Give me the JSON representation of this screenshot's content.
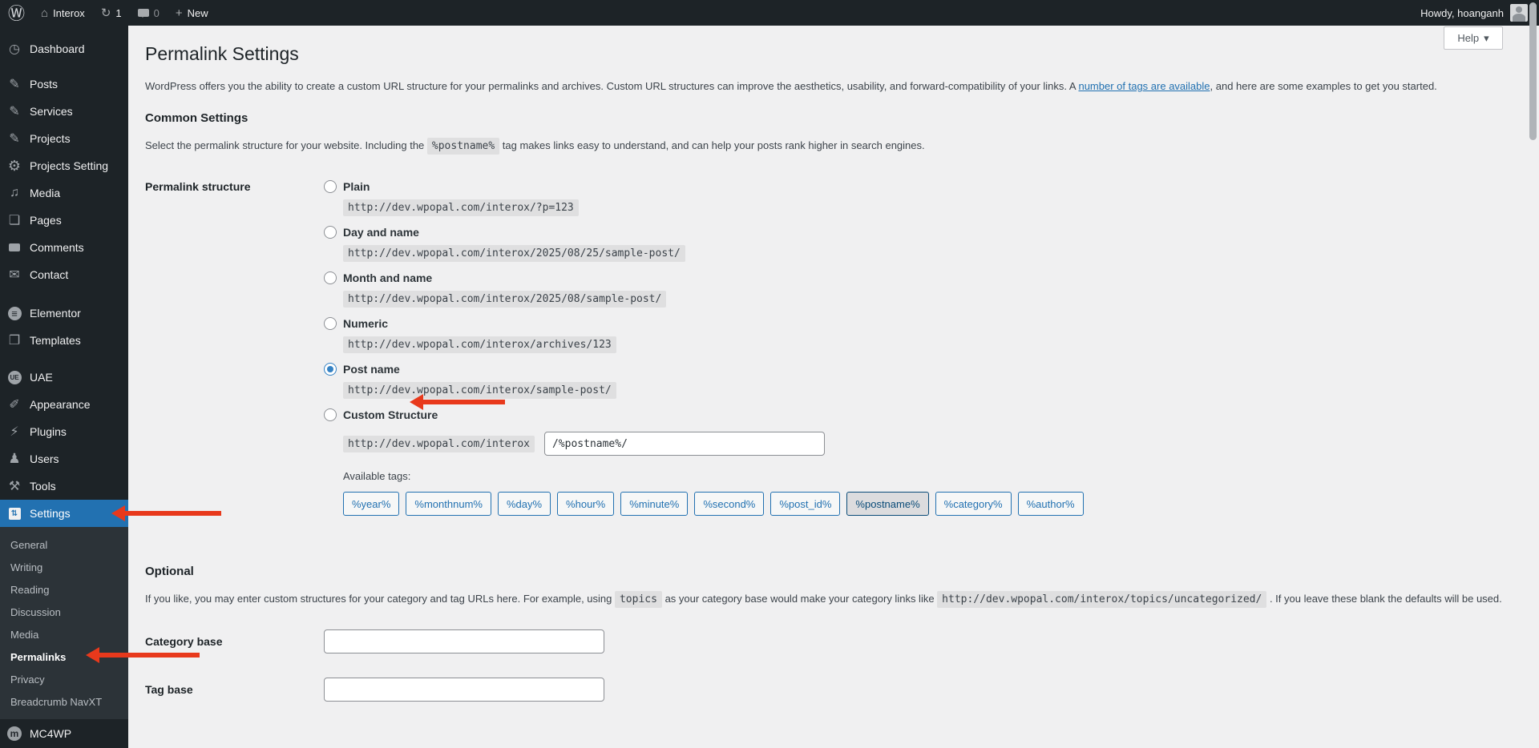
{
  "admin_bar": {
    "site_name": "Interox",
    "update_count": "1",
    "comment_count": "0",
    "new_label": "New",
    "howdy_text": "Howdy, hoanganh"
  },
  "sidebar": {
    "items": [
      {
        "label": "Dashboard",
        "icon": "dashboard-icon"
      },
      {
        "label": "Posts",
        "icon": "pin-icon"
      },
      {
        "label": "Services",
        "icon": "pin-icon"
      },
      {
        "label": "Projects",
        "icon": "pin-icon"
      },
      {
        "label": "Projects Setting",
        "icon": "gear-icon"
      },
      {
        "label": "Media",
        "icon": "media-icon"
      },
      {
        "label": "Pages",
        "icon": "pages-icon"
      },
      {
        "label": "Comments",
        "icon": "comment-bubble-icon"
      },
      {
        "label": "Contact",
        "icon": "mail-icon"
      },
      {
        "label": "Elementor",
        "icon": "elementor-icon"
      },
      {
        "label": "Templates",
        "icon": "folder-icon"
      },
      {
        "label": "UAE",
        "icon": "uae-icon"
      },
      {
        "label": "Appearance",
        "icon": "brush-icon"
      },
      {
        "label": "Plugins",
        "icon": "plug-icon"
      },
      {
        "label": "Users",
        "icon": "person-icon"
      },
      {
        "label": "Tools",
        "icon": "wrench-icon"
      },
      {
        "label": "Settings",
        "icon": "sliders-icon",
        "active": true
      }
    ],
    "active_item": "Settings",
    "settings_submenu": [
      {
        "label": "General"
      },
      {
        "label": "Writing"
      },
      {
        "label": "Reading"
      },
      {
        "label": "Discussion"
      },
      {
        "label": "Media"
      },
      {
        "label": "Permalinks",
        "current": true
      },
      {
        "label": "Privacy"
      },
      {
        "label": "Breadcrumb NavXT"
      }
    ],
    "mc4wp_label": "MC4WP"
  },
  "page": {
    "help_label": "Help",
    "help_caret": "▾",
    "title": "Permalink Settings",
    "intro_before": "WordPress offers you the ability to create a custom URL structure for your permalinks and archives. Custom URL structures can improve the aesthetics, usability, and forward-compatibility of your links. A ",
    "intro_link": "number of tags are available",
    "intro_after": ", and here are some examples to get you started.",
    "common": {
      "heading": "Common Settings",
      "desc_before": "Select the permalink structure for your website. Including the ",
      "desc_code": "%postname%",
      "desc_after": " tag makes links easy to understand, and can help your posts rank higher in search engines.",
      "row_label": "Permalink structure",
      "options": [
        {
          "label": "Plain",
          "example": "http://dev.wpopal.com/interox/?p=123",
          "selected": false
        },
        {
          "label": "Day and name",
          "example": "http://dev.wpopal.com/interox/2025/08/25/sample-post/",
          "selected": false
        },
        {
          "label": "Month and name",
          "example": "http://dev.wpopal.com/interox/2025/08/sample-post/",
          "selected": false
        },
        {
          "label": "Numeric",
          "example": "http://dev.wpopal.com/interox/archives/123",
          "selected": false
        },
        {
          "label": "Post name",
          "example": "http://dev.wpopal.com/interox/sample-post/",
          "selected": true
        }
      ],
      "custom": {
        "label": "Custom Structure",
        "url_prefix": "http://dev.wpopal.com/interox",
        "input_value": "/%postname%/",
        "selected": false
      },
      "available_tags_label": "Available tags:",
      "tags": [
        "%year%",
        "%monthnum%",
        "%day%",
        "%hour%",
        "%minute%",
        "%second%",
        "%post_id%",
        "%postname%",
        "%category%",
        "%author%"
      ],
      "selected_tag": "%postname%"
    },
    "optional": {
      "heading": "Optional",
      "desc_part1": "If you like, you may enter custom structures for your category and tag URLs here. For example, using ",
      "desc_code1": "topics",
      "desc_part2": " as your category base would make your category links like ",
      "desc_code2": "http://dev.wpopal.com/interox/topics/uncategorized/",
      "desc_part3": " . If you leave these blank the defaults will be used.",
      "category_base_label": "Category base",
      "category_base_value": "",
      "tag_base_label": "Tag base",
      "tag_base_value": ""
    }
  },
  "annotations": {
    "arrow_color": "#e8391c",
    "arrows": [
      "arrow-at-settings-menu",
      "arrow-at-permalinks-submenu",
      "arrow-at-post-name-option"
    ]
  }
}
